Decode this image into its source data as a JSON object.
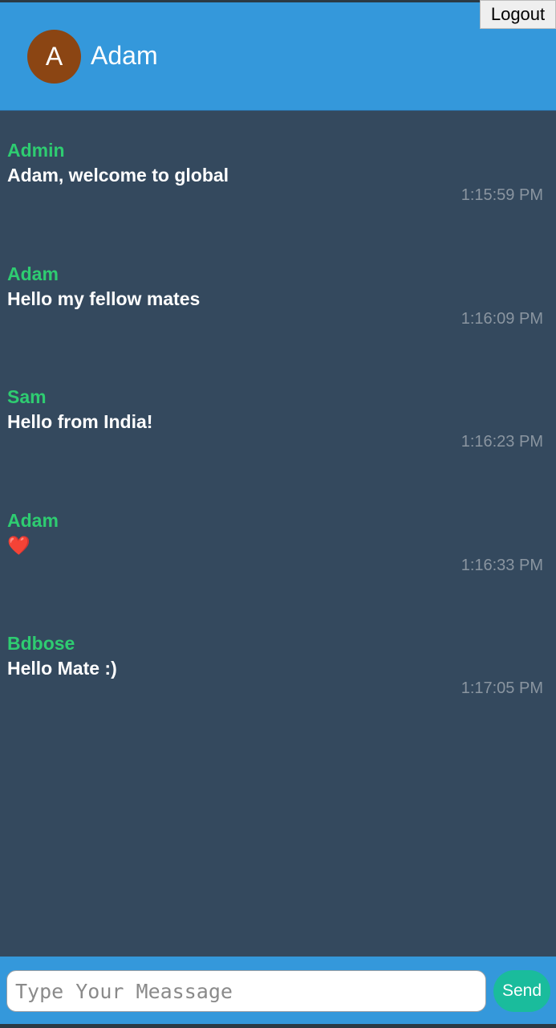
{
  "header": {
    "avatar_initial": "A",
    "username": "Adam",
    "logout_label": "Logout"
  },
  "messages": [
    {
      "sender": "Admin",
      "text": "Adam, welcome to global",
      "time": "1:15:59 PM"
    },
    {
      "sender": "Adam",
      "text": "Hello my fellow mates",
      "time": "1:16:09 PM"
    },
    {
      "sender": "Sam",
      "text": "Hello from India!",
      "time": "1:16:23 PM"
    },
    {
      "sender": "Adam",
      "text": "❤️",
      "time": "1:16:33 PM"
    },
    {
      "sender": "Bdbose",
      "text": "Hello Mate :)",
      "time": "1:17:05 PM"
    }
  ],
  "composer": {
    "placeholder": "Type Your Meassage",
    "value": "",
    "send_label": "Send"
  },
  "colors": {
    "header_bg": "#3498db",
    "chat_bg": "#34495e",
    "sender": "#2ecc71",
    "send_button": "#1abc9c",
    "avatar": "#8b4513"
  }
}
